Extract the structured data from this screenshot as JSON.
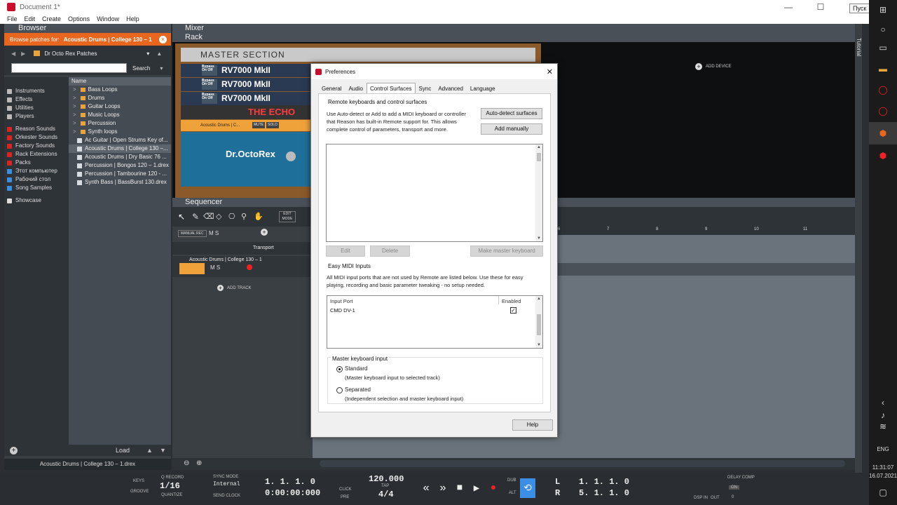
{
  "window": {
    "title": "Document 1*",
    "tooltip": "Пуск",
    "menu": [
      "File",
      "Edit",
      "Create",
      "Options",
      "Window",
      "Help"
    ]
  },
  "browser": {
    "title": "Browser",
    "browse_prefix": "Browse patches for:",
    "browse_target": "Acoustic Drums | College   130 – 1",
    "folder": "Dr Octo Rex Patches",
    "search_button": "Search",
    "locations": [
      {
        "label": "Instruments",
        "color": "#bbbbbb"
      },
      {
        "label": "Effects",
        "color": "#bbbbbb"
      },
      {
        "label": "Utilities",
        "color": "#bbbbbb"
      },
      {
        "label": "Players",
        "color": "#bbbbbb"
      },
      {
        "label": "Reason Sounds",
        "color": "#d22"
      },
      {
        "label": "Orkester Sounds",
        "color": "#d22"
      },
      {
        "label": "Factory Sounds",
        "color": "#d22"
      },
      {
        "label": "Rack Extensions",
        "color": "#d22"
      },
      {
        "label": "Packs",
        "color": "#d22"
      },
      {
        "label": "Этот компьютер",
        "color": "#3a8ee6"
      },
      {
        "label": "Рабочий стол",
        "color": "#3a8ee6"
      },
      {
        "label": "Song Samples",
        "color": "#3a8ee6"
      },
      {
        "label": "Showcase",
        "color": "#dddddd"
      }
    ],
    "column_header": "Name",
    "files": [
      {
        "name": "Bass Loops",
        "type": "folder"
      },
      {
        "name": "Drums",
        "type": "folder"
      },
      {
        "name": "Guitar Loops",
        "type": "folder"
      },
      {
        "name": "Music Loops",
        "type": "folder"
      },
      {
        "name": "Percussion",
        "type": "folder"
      },
      {
        "name": "Synth loops",
        "type": "folder"
      },
      {
        "name": "Ac Guitar | Open Strums  Key of...",
        "type": "file"
      },
      {
        "name": "Acoustic Drums | College  130 –...",
        "type": "file"
      },
      {
        "name": "Acoustic Drums | Dry Basic  76 ...",
        "type": "file"
      },
      {
        "name": "Percussion | Bongos  120 – 1.drex",
        "type": "file"
      },
      {
        "name": "Percussion | Tambourine  120 - ...",
        "type": "file"
      },
      {
        "name": "Synth Bass | BassBurst  130.drex",
        "type": "file"
      }
    ],
    "load_button": "Load",
    "status": "Acoustic Drums | College   130 – 1.drex"
  },
  "mixer": {
    "title": "Mixer"
  },
  "rack": {
    "title": "Rack",
    "master_section": "MASTER SECTION",
    "rv7000": "RV7000 MkII",
    "bypass": "Bypass On Off",
    "echo": "THE ECHO",
    "drum_patch": "Acoustic Drums | C...",
    "mute": "MUTE",
    "solo": "SOLO",
    "octorex": "Dr.OctoRex",
    "add_device": "ADD DEVICE"
  },
  "tutorial": "Tutorial",
  "sequencer": {
    "title": "Sequencer",
    "manual_rec": "MANUAL REC",
    "ms": "M S",
    "edit_mode": "EDIT MODE",
    "transport_track": "Transport",
    "drum_track": "Acoustic Drums | College   130 – 1",
    "add_track": "ADD TRACK",
    "ruler": [
      "6",
      "7",
      "8",
      "9",
      "10",
      "11"
    ]
  },
  "transport": {
    "keys": "KEYS",
    "groove": "GROOVE",
    "quantize_label": "Q RECORD",
    "quantize": "1/16",
    "quantize_sub": "QUANTIZE",
    "sync_mode": "SYNC MODE",
    "sync_value": "Internal",
    "send_clock": "SEND CLOCK",
    "position": "1.  1.  1.   0",
    "time": "0:00:00:000",
    "click": "CLICK",
    "pre": "PRE",
    "tempo": "120.000",
    "tap": "TAP",
    "signature": "4/4",
    "dub": "DUB",
    "alt": "ALT",
    "loop_l_label": "L",
    "loop_r_label": "R",
    "loop_l": "1.  1.  1.   0",
    "loop_r": "5.  1.  1.   0",
    "dsp": "DSP",
    "in": "IN",
    "out": "OUT",
    "delay_comp": "DELAY COMP",
    "on": "ON",
    "delay_value": "0"
  },
  "taskbar": {
    "lang": "ENG",
    "time": "11:31:07",
    "date": "16.07.2021"
  },
  "preferences": {
    "title": "Preferences",
    "tabs": [
      "General",
      "Audio",
      "Control Surfaces",
      "Sync",
      "Advanced",
      "Language"
    ],
    "active_tab": "Control Surfaces",
    "remote_title": "Remote keyboards and control surfaces",
    "remote_desc_1": "Use Auto-detect or Add to add a MIDI keyboard or controller",
    "remote_desc_2": "that Reason has built-in Remote support for. This allows",
    "remote_desc_3": "complete control of parameters, transport and more.",
    "auto_detect": "Auto-detect surfaces",
    "add_manually": "Add manually",
    "edit": "Edit",
    "delete": "Delete",
    "make_master": "Make master keyboard",
    "easy_midi_title": "Easy MIDI Inputs",
    "easy_desc_1": "All MIDI input ports that are not used by Remote are listed below. Use these for easy",
    "easy_desc_2": "playing, recording and basic parameter tweaking - no setup needed.",
    "col_input": "Input Port",
    "col_enabled": "Enabled",
    "ports": [
      {
        "name": "CMD DV-1",
        "enabled": true
      }
    ],
    "master_title": "Master keyboard input",
    "standard": "Standard",
    "standard_desc": "(Master keyboard input to selected track)",
    "separated": "Separated",
    "separated_desc": "(Independent selection and master keyboard input)",
    "help": "Help"
  }
}
